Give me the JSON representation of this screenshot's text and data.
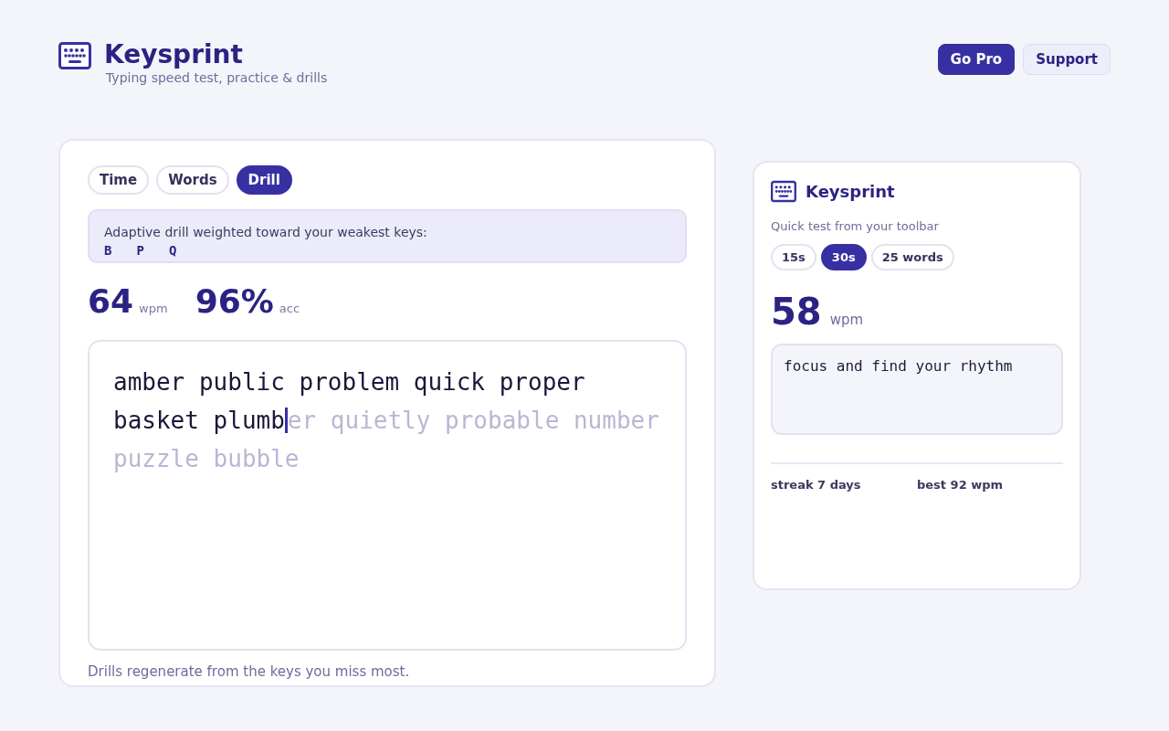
{
  "header": {
    "title": "Keysprint",
    "subtitle": "Typing speed test, practice & drills",
    "buttons": [
      {
        "label": "Go Pro",
        "kind": "primary"
      },
      {
        "label": "Support",
        "kind": "secondary"
      }
    ]
  },
  "main": {
    "modes": [
      {
        "label": "Time",
        "selected": false
      },
      {
        "label": "Words",
        "selected": false
      },
      {
        "label": "Drill",
        "selected": true
      }
    ],
    "drill_info": {
      "text": "Adaptive drill weighted toward your weakest keys:",
      "keys": [
        "B",
        "P",
        "Q"
      ]
    },
    "stats": [
      {
        "value": "64",
        "unit": "wpm"
      },
      {
        "value": "96%",
        "unit": "acc"
      }
    ],
    "typing": {
      "typed": "amber public problem quick proper basket plumb",
      "remaining": "er quietly probable number puzzle bubble"
    },
    "footer": "Drills regenerate from the keys you miss most."
  },
  "popup": {
    "title": "Keysprint",
    "subtitle": "Quick test from your toolbar",
    "options": [
      {
        "label": "15s",
        "selected": false
      },
      {
        "label": "30s",
        "selected": true
      },
      {
        "label": "25 words",
        "selected": false
      }
    ],
    "stat": {
      "value": "58",
      "unit": "wpm"
    },
    "prompt": "focus and find your rhythm",
    "stats": [
      "streak 7 days",
      "best 92 wpm"
    ]
  }
}
